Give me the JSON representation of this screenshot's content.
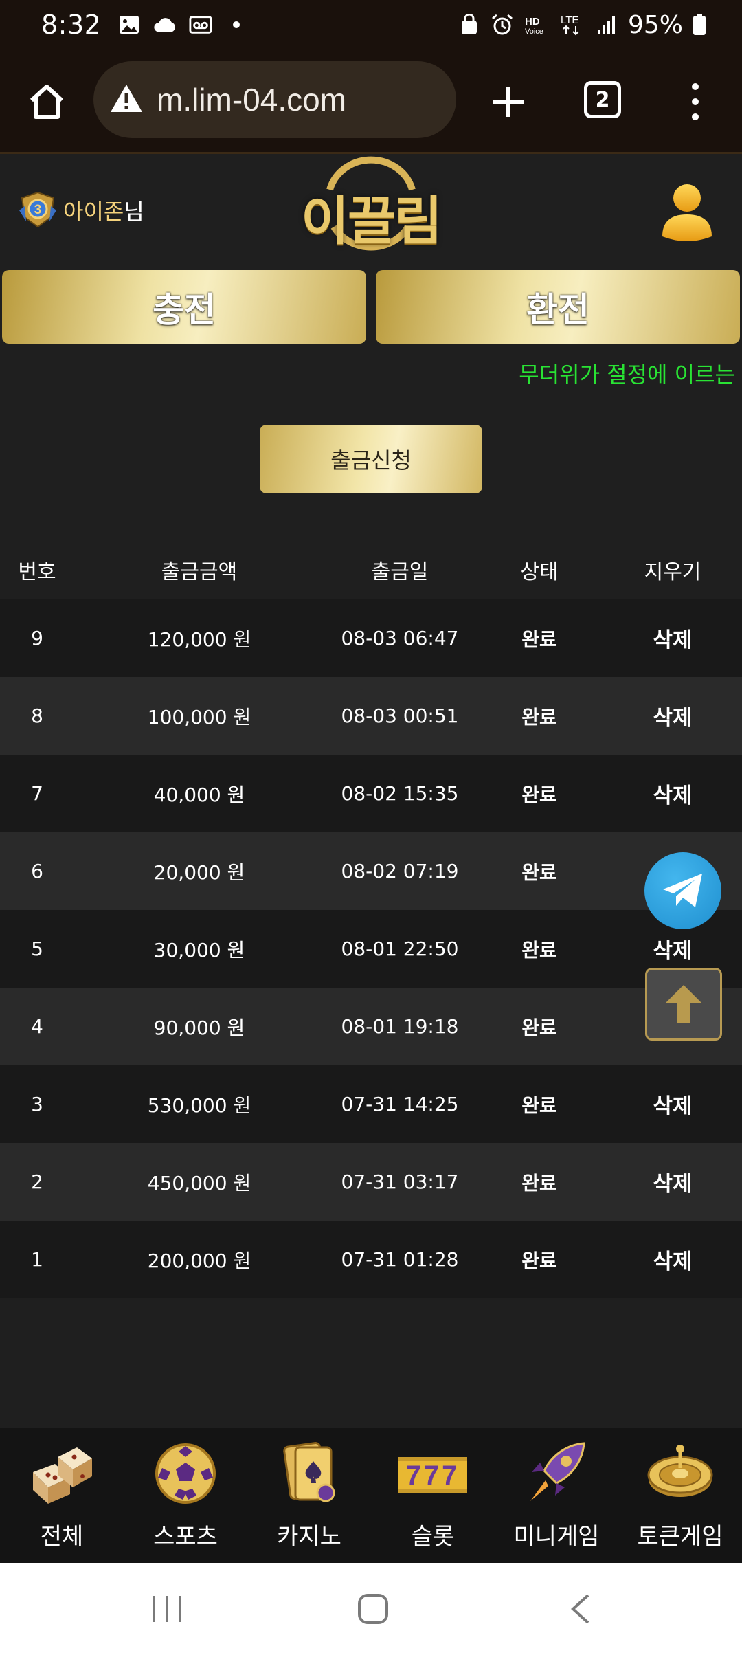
{
  "status_bar": {
    "time": "8:32",
    "battery": "95%"
  },
  "browser": {
    "url": "m.lim-04.com",
    "tab_count": "2"
  },
  "header": {
    "user_name": "아이존",
    "user_suffix": "님",
    "level": "3",
    "logo_text": "이끌림"
  },
  "actions": {
    "charge_label": "충전",
    "exchange_label": "환전",
    "withdraw_request_label": "출금신청"
  },
  "marquee": "무더위가 절정에 이르는",
  "table": {
    "headers": [
      "번호",
      "출금금액",
      "출금일",
      "상태",
      "지우기"
    ],
    "rows": [
      {
        "no": "9",
        "amount": "120,000 원",
        "date": "08-03 06:47",
        "status": "완료",
        "delete": "삭제"
      },
      {
        "no": "8",
        "amount": "100,000 원",
        "date": "08-03 00:51",
        "status": "완료",
        "delete": "삭제"
      },
      {
        "no": "7",
        "amount": "40,000 원",
        "date": "08-02 15:35",
        "status": "완료",
        "delete": "삭제"
      },
      {
        "no": "6",
        "amount": "20,000 원",
        "date": "08-02 07:19",
        "status": "완료",
        "delete": ""
      },
      {
        "no": "5",
        "amount": "30,000 원",
        "date": "08-01 22:50",
        "status": "완료",
        "delete": "삭제"
      },
      {
        "no": "4",
        "amount": "90,000 원",
        "date": "08-01 19:18",
        "status": "완료",
        "delete": ""
      },
      {
        "no": "3",
        "amount": "530,000 원",
        "date": "07-31 14:25",
        "status": "완료",
        "delete": "삭제"
      },
      {
        "no": "2",
        "amount": "450,000 원",
        "date": "07-31 03:17",
        "status": "완료",
        "delete": "삭제"
      },
      {
        "no": "1",
        "amount": "200,000 원",
        "date": "07-31 01:28",
        "status": "완료",
        "delete": "삭제"
      }
    ]
  },
  "bottom_nav": [
    {
      "label": "전체",
      "icon": "dice-icon"
    },
    {
      "label": "스포츠",
      "icon": "soccer-ball-icon"
    },
    {
      "label": "카지노",
      "icon": "playing-cards-icon"
    },
    {
      "label": "슬롯",
      "icon": "slot-777-icon",
      "icon_text": "777"
    },
    {
      "label": "미니게임",
      "icon": "rocket-icon"
    },
    {
      "label": "토큰게임",
      "icon": "roulette-icon"
    }
  ]
}
